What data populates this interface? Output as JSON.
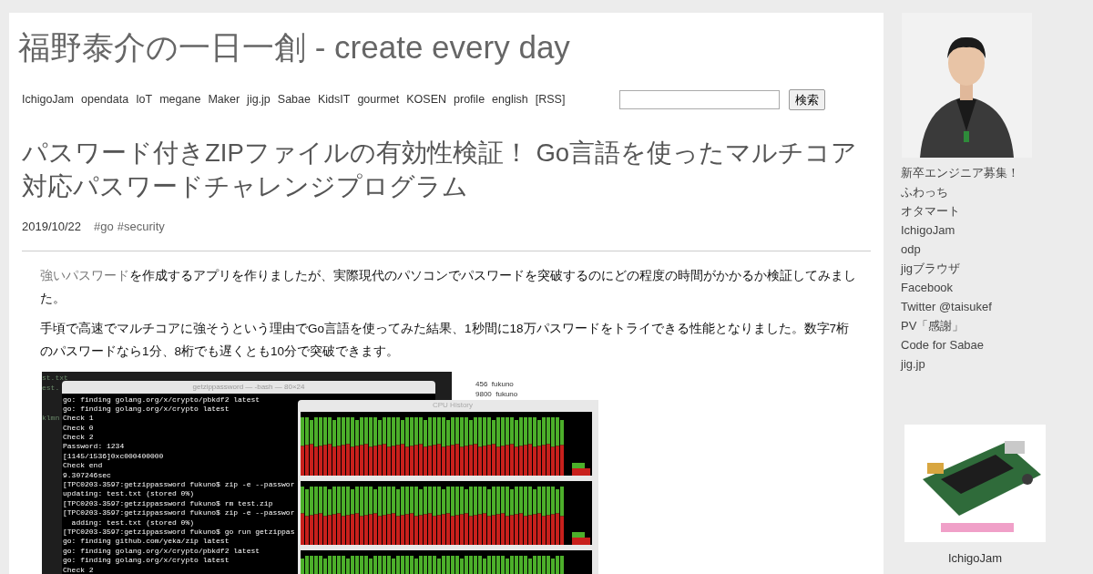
{
  "blog": {
    "title": "福野泰介の一日一創 - create every day",
    "nav": [
      "IchigoJam",
      "opendata",
      "IoT",
      "megane",
      "Maker",
      "jig.jp",
      "Sabae",
      "KidsIT",
      "gourmet",
      "KOSEN",
      "profile",
      "english",
      "[RSS]"
    ],
    "search": {
      "button": "検索"
    }
  },
  "article": {
    "title": "パスワード付きZIPファイルの有効性検証！ Go言語を使ったマルチコア対応パスワードチャレンジプログラム",
    "date": "2019/10/22",
    "tags": [
      "#go",
      "#security"
    ],
    "paragraphs": [
      {
        "link": "強いパスワード",
        "text": "を作成するアプリを作りましたが、実際現代のパソコンでパスワードを突破するのにどの程度の時間がかかるか検証してみました。"
      },
      {
        "text": "手頃で高速でマルチコアに強そうという理由でGo言語を使ってみた結果、1秒間に18万パスワードをトライできる性能となりました。数字7桁のパスワードなら1分、8桁でも遅くとも10分で突破できます。"
      }
    ],
    "screenshot": {
      "editor_lines": [
        "st.txt",
        "est.",
        "klmn"
      ],
      "process_rows": [
        "456  fukuno",
        "9800  fukuno"
      ],
      "terminal": {
        "title": "getzippassword — -bash — 80×24",
        "lines": [
          "go: finding golang.org/x/crypto/pbkdf2 latest",
          "go: finding golang.org/x/crypto latest",
          "Check 1",
          "Check 0",
          "Check 2",
          "Password: 1234",
          "[1145/1536]0xc000400000",
          "Check end",
          "9.307246sec",
          "[TPC0203-3597:getzippassword fukuno$ zip -e --passwor",
          "updating: test.txt (stored 0%)",
          "[TPC0203-3597:getzippassword fukuno$ rm test.zip",
          "[TPC0203-3597:getzippassword fukuno$ zip -e --passwor",
          "  adding: test.txt (stored 0%)",
          "[TPC0203-3597:getzippassword fukuno$ go run getzippas",
          "go: finding github.com/yeka/zip latest",
          "go: finding golang.org/x/crypto/pbkdf2 latest",
          "go: finding golang.org/x/crypto latest",
          "Check 2"
        ]
      },
      "cpu_window": {
        "title": "CPU History"
      }
    }
  },
  "sidebar": {
    "links": [
      "新卒エンジニア募集！",
      "ふわっち",
      "オタマート",
      "IchigoJam",
      "odp",
      "jigブラウザ",
      "Facebook",
      "Twitter @taisukef",
      "PV「感謝」",
      "Code for Sabae",
      "jig.jp"
    ],
    "banner": {
      "caption": "IchigoJam"
    }
  }
}
